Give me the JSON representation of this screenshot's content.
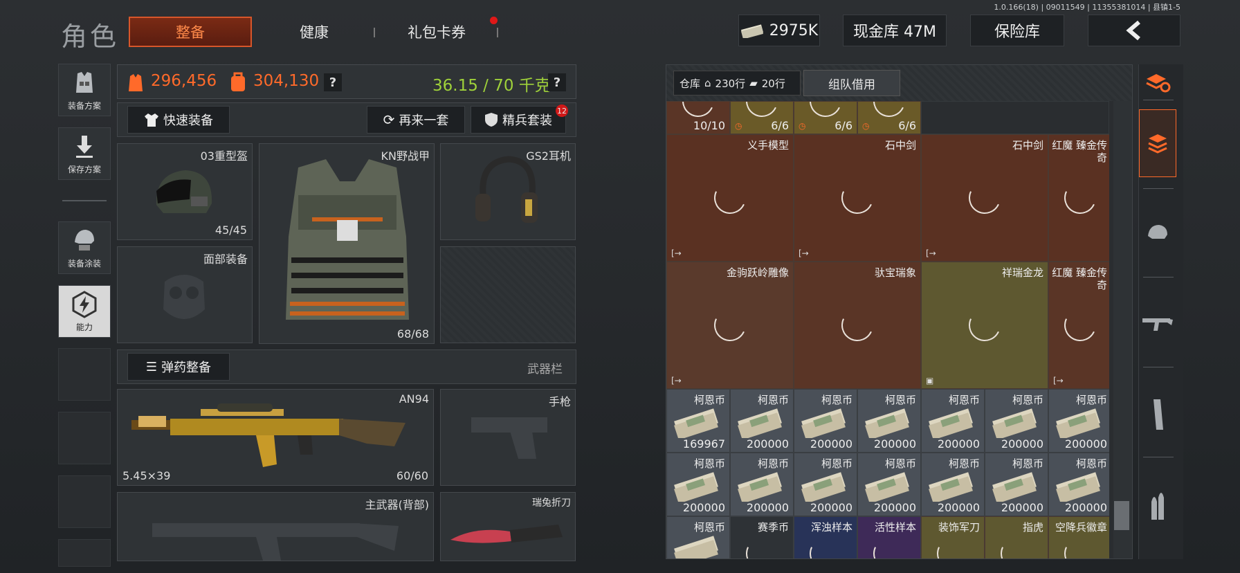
{
  "version": "1.0.166(18) | 09011549 | 11355381014 | 县镇1-5",
  "header": {
    "title": "角色",
    "tabs": [
      {
        "label": "整备"
      },
      {
        "label": "健康"
      },
      {
        "label": "礼包卡券"
      }
    ],
    "cash_small": "2975K",
    "vault": "现金库 47M",
    "safe": "保险库"
  },
  "left_menu": [
    {
      "label": "装备方案"
    },
    {
      "label": "保存方案"
    },
    {
      "label": "装备涂装"
    },
    {
      "label": "能力"
    }
  ],
  "stats": {
    "value1": "296,456",
    "value2": "304,130",
    "weight": "36.15 / 70 千克",
    "help": "?"
  },
  "actions": {
    "quick_equip": "快速装备",
    "again": "再来一套",
    "elite": "精兵套装",
    "elite_badge": "12",
    "ammo": "弹药整备",
    "weapon_bar": "武器栏"
  },
  "slots": {
    "helmet": {
      "label": "03重型盔",
      "count": "45/45"
    },
    "armor": {
      "label": "KN野战甲",
      "count": "68/68"
    },
    "headset": {
      "label": "GS2耳机"
    },
    "face": {
      "label": "面部装备"
    },
    "primary": {
      "label": "AN94",
      "ammo": "5.45×39",
      "count": "60/60"
    },
    "pistol": {
      "label": "手枪"
    },
    "back": {
      "label": "主武器(背部)"
    },
    "knife": {
      "label": "瑞兔折刀"
    }
  },
  "warehouse": {
    "label": "仓库",
    "rows1": "230行",
    "rows2": "20行",
    "team_borrow": "组队借用",
    "top_row": [
      "10/10",
      "6/6",
      "6/6",
      "6/6"
    ],
    "items_row1": [
      "义手模型",
      "石中剑",
      "石中剑",
      "红魔 臻金传奇"
    ],
    "items_row2": [
      "金驹跃岭雕像",
      "驮宝瑞象",
      "祥瑞金龙",
      "红魔 臻金传奇"
    ],
    "coin_label": "柯恩币",
    "coins_row1": [
      "169967",
      "200000",
      "200000",
      "200000",
      "200000",
      "200000",
      "200000"
    ],
    "coins_row2": [
      "200000",
      "200000",
      "200000",
      "200000",
      "200000",
      "200000",
      "200000"
    ],
    "bottom_row": [
      "柯恩币",
      "赛季币",
      "浑浊样本",
      "活性样本",
      "装饰军刀",
      "指虎",
      "空降兵徽章"
    ]
  },
  "colors": {
    "accent": "#ff6a2a",
    "weight_green": "#9fd13a",
    "brown_cell": "#5a3526",
    "gold_cell": "#6a6230"
  }
}
